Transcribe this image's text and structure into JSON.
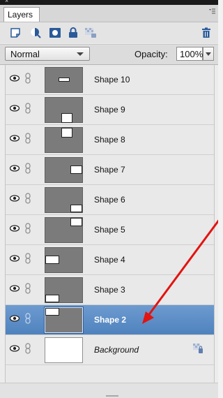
{
  "window": {
    "close_glyph": "×"
  },
  "tabs": [
    {
      "label": "Layers"
    }
  ],
  "panel_menu_icon": "panel-menu-icon",
  "toolbar": {
    "icons": [
      "new-layer-icon",
      "adjustment-layer-icon",
      "layer-mask-icon",
      "lock-all-icon",
      "lock-transparency-icon",
      "trash-icon"
    ]
  },
  "blend": {
    "mode": "Normal"
  },
  "opacity": {
    "label": "Opacity:",
    "value": "100%"
  },
  "colors": {
    "selected_row": "#5b8dc6",
    "thumb_gray": "#7b7b7b",
    "annotation_arrow": "#e3130f"
  },
  "layers": [
    {
      "name": "Shape 10",
      "selected": false
    },
    {
      "name": "Shape 9",
      "selected": false
    },
    {
      "name": "Shape 8",
      "selected": false
    },
    {
      "name": "Shape 7",
      "selected": false
    },
    {
      "name": "Shape 6",
      "selected": false
    },
    {
      "name": "Shape 5",
      "selected": false
    },
    {
      "name": "Shape 4",
      "selected": false
    },
    {
      "name": "Shape 3",
      "selected": false
    },
    {
      "name": "Shape 2",
      "selected": true
    },
    {
      "name": "Background",
      "selected": false,
      "locked": true
    }
  ]
}
